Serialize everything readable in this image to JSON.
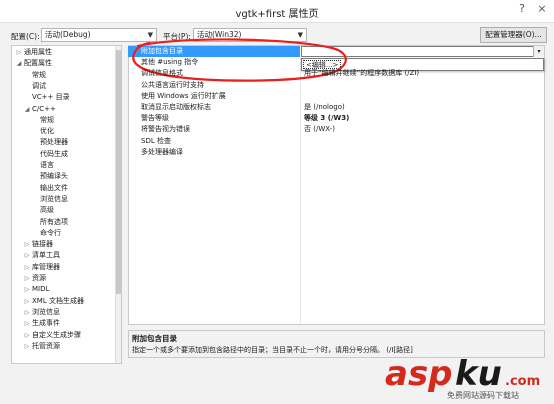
{
  "window": {
    "title": "vgtk+first 属性页",
    "help_button": "?",
    "close_button": "×"
  },
  "toolbar": {
    "config_label": "配置(C):",
    "config_value": "活动(Debug)",
    "platform_label": "平台(P):",
    "platform_value": "活动(Win32)",
    "config_manager_label": "配置管理器(O)..."
  },
  "tree": {
    "items": [
      {
        "label": "通用属性",
        "level": 0,
        "arrow": "▷"
      },
      {
        "label": "配置属性",
        "level": 0,
        "arrow": "◢"
      },
      {
        "label": "常规",
        "level": 1,
        "arrow": ""
      },
      {
        "label": "调试",
        "level": 1,
        "arrow": ""
      },
      {
        "label": "VC++ 目录",
        "level": 1,
        "arrow": ""
      },
      {
        "label": "C/C++",
        "level": 1,
        "arrow": "◢"
      },
      {
        "label": "常规",
        "level": 2,
        "arrow": ""
      },
      {
        "label": "优化",
        "level": 2,
        "arrow": ""
      },
      {
        "label": "预处理器",
        "level": 2,
        "arrow": ""
      },
      {
        "label": "代码生成",
        "level": 2,
        "arrow": ""
      },
      {
        "label": "语言",
        "level": 2,
        "arrow": ""
      },
      {
        "label": "预编译头",
        "level": 2,
        "arrow": ""
      },
      {
        "label": "输出文件",
        "level": 2,
        "arrow": ""
      },
      {
        "label": "浏览信息",
        "level": 2,
        "arrow": ""
      },
      {
        "label": "高级",
        "level": 2,
        "arrow": ""
      },
      {
        "label": "所有选项",
        "level": 2,
        "arrow": ""
      },
      {
        "label": "命令行",
        "level": 2,
        "arrow": ""
      },
      {
        "label": "链接器",
        "level": 1,
        "arrow": "▷"
      },
      {
        "label": "清单工具",
        "level": 1,
        "arrow": "▷"
      },
      {
        "label": "库管理器",
        "level": 1,
        "arrow": "▷"
      },
      {
        "label": "资源",
        "level": 1,
        "arrow": "▷"
      },
      {
        "label": "MIDL",
        "level": 1,
        "arrow": "▷"
      },
      {
        "label": "XML 文档生成器",
        "level": 1,
        "arrow": "▷"
      },
      {
        "label": "浏览信息",
        "level": 1,
        "arrow": "▷"
      },
      {
        "label": "生成事件",
        "level": 1,
        "arrow": "▷"
      },
      {
        "label": "自定义生成步骤",
        "level": 1,
        "arrow": "▷"
      },
      {
        "label": "托管资源",
        "level": 1,
        "arrow": "▷"
      }
    ]
  },
  "grid": {
    "rows": [
      {
        "name": "附加包含目录",
        "value": ""
      },
      {
        "name": "其他 #using 指令",
        "value": ""
      },
      {
        "name": "调试信息格式",
        "value": "用于“编辑并继续”的程序数据库 (/ZI)"
      },
      {
        "name": "公共语言运行时支持",
        "value": ""
      },
      {
        "name": "使用 Windows 运行时扩展",
        "value": ""
      },
      {
        "name": "取消显示启动版权标志",
        "value": "是 (/nologo)"
      },
      {
        "name": "警告等级",
        "value": "等级 3 (/W3)"
      },
      {
        "name": "将警告视为错误",
        "value": "否 (/WX-)"
      },
      {
        "name": "SDL 检查",
        "value": ""
      },
      {
        "name": "多处理器编译",
        "value": ""
      }
    ],
    "dropdown_arrow": "▾",
    "popup_item": "<编辑...>"
  },
  "description": {
    "title": "附加包含目录",
    "text": "指定一个或多个要添加到包含路径中的目录；当目录不止一个时，请用分号分隔。     (/I[路径]"
  },
  "watermark": {
    "logo": "aspku.com",
    "subtitle": "免费网站源码下载站"
  },
  "colors": {
    "selection": "#3399ff",
    "annotation": "#e8201c"
  }
}
